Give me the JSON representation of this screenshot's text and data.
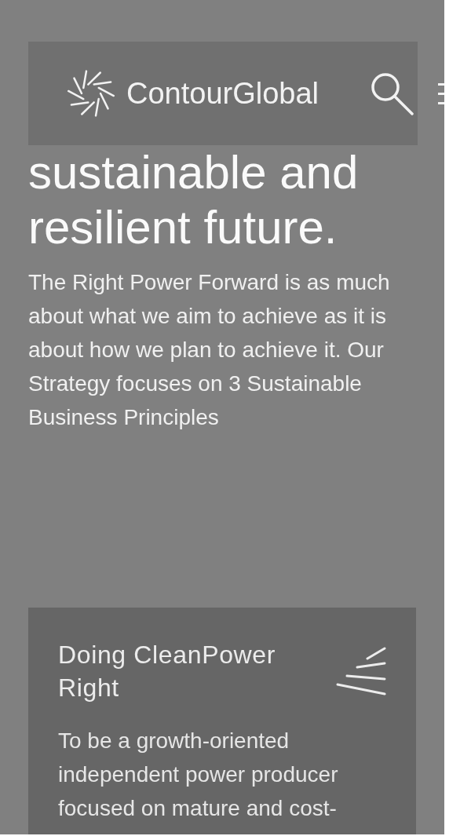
{
  "header": {
    "logo_text": "ContourGlobal"
  },
  "hero": {
    "heading": "sustainable and resilient future.",
    "paragraph": "The Right Power Forward is as much about what we aim to achieve as it is about how we plan to achieve it. Our Strategy focuses on 3 Sustainable Business Principles"
  },
  "cards": [
    {
      "title": "Doing CleanPower Right",
      "body": "To be a growth-oriented independent power producer focused on mature and cost-"
    }
  ]
}
